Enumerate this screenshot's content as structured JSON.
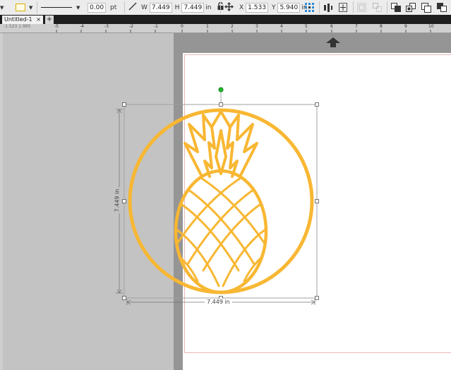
{
  "toolbar": {
    "stroke_weight": "0.00",
    "stroke_unit": "pt",
    "w_label": "W",
    "w_value": "7.449",
    "h_label": "H",
    "h_value": "7.449",
    "size_unit": "in",
    "x_label": "X",
    "x_value": "1.533",
    "y_label": "Y",
    "y_value": "5.940",
    "pos_unit": "in"
  },
  "tabs": [
    {
      "label": "Untitled-1",
      "close": "×"
    }
  ],
  "new_tab": "+",
  "ruler": {
    "readout": "-1.523  1.995",
    "labels": [
      "-5",
      "-4",
      "-3",
      "-2",
      "-1",
      "0",
      "1",
      "2",
      "3",
      "4",
      "5",
      "6",
      "7",
      "8",
      "9",
      "10"
    ]
  },
  "selection": {
    "width_label": "7.449 in",
    "height_label": "7.449 in"
  },
  "design": {
    "color": "#F8B733",
    "rotate_handle_color": "#1fbf2a"
  },
  "icons": {
    "mat_arrow": "up-arrow-icon"
  }
}
